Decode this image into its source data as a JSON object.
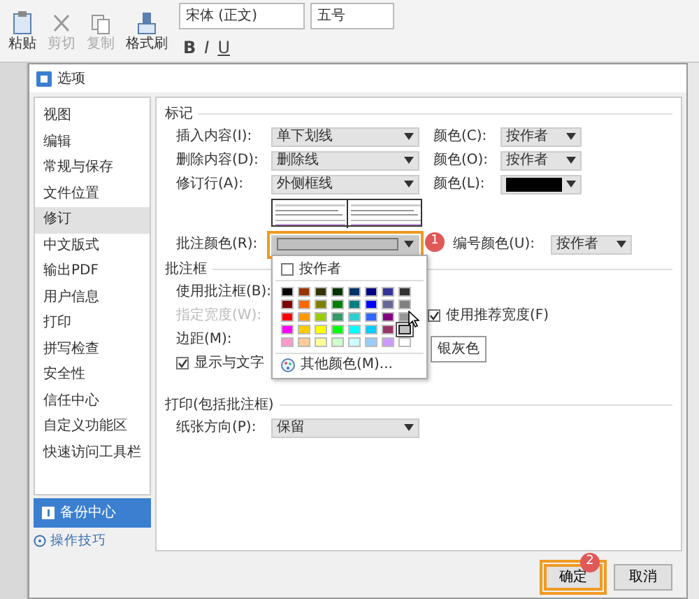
{
  "toolbar": {
    "clipboard": [
      {
        "label": "粘贴",
        "disabled": false
      },
      {
        "label": "剪切",
        "disabled": true
      },
      {
        "label": "复制",
        "disabled": true
      },
      {
        "label": "格式刷",
        "disabled": false
      }
    ],
    "font": "宋体 (正文)",
    "size": "五号",
    "format_buttons": [
      "B",
      "I",
      "U"
    ]
  },
  "dialog": {
    "title": "选项",
    "sidebar": {
      "items": [
        {
          "label": "视图",
          "selected": false
        },
        {
          "label": "编辑",
          "selected": false
        },
        {
          "label": "常规与保存",
          "selected": false
        },
        {
          "label": "文件位置",
          "selected": false
        },
        {
          "label": "修订",
          "selected": true
        },
        {
          "label": "中文版式",
          "selected": false
        },
        {
          "label": "输出PDF",
          "selected": false
        },
        {
          "label": "用户信息",
          "selected": false
        },
        {
          "label": "打印",
          "selected": false
        },
        {
          "label": "拼写检查",
          "selected": false
        },
        {
          "label": "安全性",
          "selected": false
        },
        {
          "label": "信任中心",
          "selected": false
        },
        {
          "label": "自定义功能区",
          "selected": false
        },
        {
          "label": "快速访问工具栏",
          "selected": false
        }
      ],
      "backup_button": "备份中心",
      "tips_link": "操作技巧"
    },
    "markup": {
      "heading": "标记",
      "rows": [
        {
          "label": "插入内容(I):",
          "value": "单下划线",
          "color_label": "颜色(C):",
          "color_value": "按作者",
          "kind": "text"
        },
        {
          "label": "删除内容(D):",
          "value": "删除线",
          "color_label": "颜色(O):",
          "color_value": "按作者",
          "kind": "text"
        },
        {
          "label": "修订行(A):",
          "value": "外侧框线",
          "color_label": "颜色(L):",
          "color": "#000000",
          "kind": "swatch"
        }
      ],
      "comment_color_label": "批注颜色(R):",
      "number_color_label": "编号颜色(U):",
      "number_color_value": "按作者"
    },
    "color_popup": {
      "by_author": "按作者",
      "by_author_checked": false,
      "colors": [
        {
          "color": "#000000",
          "hovered": false
        },
        {
          "color": "#993300",
          "hovered": false
        },
        {
          "color": "#333300",
          "hovered": false
        },
        {
          "color": "#003300",
          "hovered": false
        },
        {
          "color": "#003366",
          "hovered": false
        },
        {
          "color": "#000080",
          "hovered": false
        },
        {
          "color": "#333399",
          "hovered": false
        },
        {
          "color": "#333333",
          "hovered": false
        },
        {
          "color": "#800000",
          "hovered": false
        },
        {
          "color": "#ff6600",
          "hovered": false
        },
        {
          "color": "#808000",
          "hovered": false
        },
        {
          "color": "#008000",
          "hovered": false
        },
        {
          "color": "#008080",
          "hovered": false
        },
        {
          "color": "#0000ff",
          "hovered": false
        },
        {
          "color": "#666699",
          "hovered": false
        },
        {
          "color": "#808080",
          "hovered": false
        },
        {
          "color": "#ff0000",
          "hovered": false
        },
        {
          "color": "#ff9900",
          "hovered": false
        },
        {
          "color": "#99cc00",
          "hovered": false
        },
        {
          "color": "#339966",
          "hovered": false
        },
        {
          "color": "#33cccc",
          "hovered": false
        },
        {
          "color": "#3366ff",
          "hovered": false
        },
        {
          "color": "#800080",
          "hovered": false
        },
        {
          "color": "#969696",
          "hovered": false
        },
        {
          "color": "#ff00ff",
          "hovered": false
        },
        {
          "color": "#ffcc00",
          "hovered": false
        },
        {
          "color": "#ffff00",
          "hovered": false
        },
        {
          "color": "#00ff00",
          "hovered": false
        },
        {
          "color": "#00ffff",
          "hovered": false
        },
        {
          "color": "#00ccff",
          "hovered": false
        },
        {
          "color": "#993366",
          "hovered": false
        },
        {
          "color": "#c0c0c0",
          "hovered": true
        },
        {
          "color": "#ff99cc",
          "hovered": false
        },
        {
          "color": "#ffcc99",
          "hovered": false
        },
        {
          "color": "#ffff99",
          "hovered": false
        },
        {
          "color": "#ccffcc",
          "hovered": false
        },
        {
          "color": "#ccffff",
          "hovered": false
        },
        {
          "color": "#99ccff",
          "hovered": false
        },
        {
          "color": "#cc99ff",
          "hovered": false
        },
        {
          "color": "#ffffff",
          "hovered": false
        }
      ],
      "more_colors": "其他颜色(M)...",
      "tooltip": "银灰色"
    },
    "balloons": {
      "heading": "批注框",
      "use_label": "使用批注框(B):",
      "width_label": "指定宽度(W):",
      "width_disabled": true,
      "margin_label": "边距(M):",
      "show_lines": "显示与文字",
      "show_lines_checked": true,
      "recommended": "使用推荐宽度(F)",
      "recommended_checked": true
    },
    "print": {
      "heading": "打印(包括批注框)",
      "orientation_label": "纸张方向(P):",
      "orientation_value": "保留"
    },
    "buttons": [
      {
        "label": "确定",
        "highlighted": true
      },
      {
        "label": "取消",
        "highlighted": false
      }
    ],
    "step_badges": [
      "1",
      "2"
    ]
  }
}
